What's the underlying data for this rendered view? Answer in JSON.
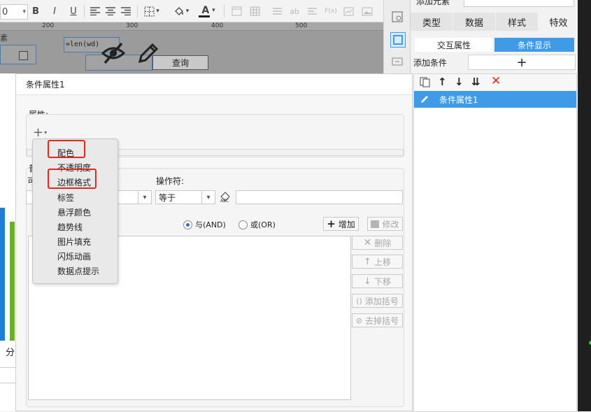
{
  "toolbar": {
    "font_size_value": "0",
    "bold": "B",
    "italic": "I",
    "underline": "U",
    "font_color_glyph": "A",
    "text_glyph": "ab",
    "formula_glyph": "F(x)"
  },
  "ruler": {
    "tick1": "200",
    "tick2": "300",
    "tick3": "400",
    "tick4": "500"
  },
  "canvas": {
    "left_label": "素",
    "formula_text": "=len(wd)",
    "query_button": "查询"
  },
  "right_panel": {
    "top_label": "添加元素",
    "tabs": [
      "类型",
      "数据",
      "样式",
      "特效"
    ],
    "subtabs": [
      "交互属性",
      "条件显示"
    ],
    "add_condition": "添加条件",
    "add_glyph": "+",
    "condition_item": "条件属性1"
  },
  "dialog": {
    "title": "条件属性1",
    "properties_label": "属性:",
    "common_label": "普",
    "can_label": "可",
    "operator_label": "操作符:",
    "operator_value": "等于",
    "and_label": "与(AND)",
    "or_label": "或(OR)",
    "add_button": "增加",
    "modify_button": "修改",
    "delete_button": "删除",
    "up_button": "上移",
    "down_button": "下移",
    "add_bracket_button": "添加括号",
    "remove_bracket_button": "去掉括号"
  },
  "menu": {
    "items": [
      "配色",
      "不透明度",
      "边框格式",
      "标签",
      "悬浮颜色",
      "趋势线",
      "图片填充",
      "闪烁动画",
      "数据点提示"
    ]
  },
  "left_bg": {
    "text": "分"
  },
  "colors": {
    "accent": "#3f9be8",
    "highlight": "#e0271f",
    "chart_blue": "#1f7fd4",
    "chart_green": "#6ab024"
  }
}
